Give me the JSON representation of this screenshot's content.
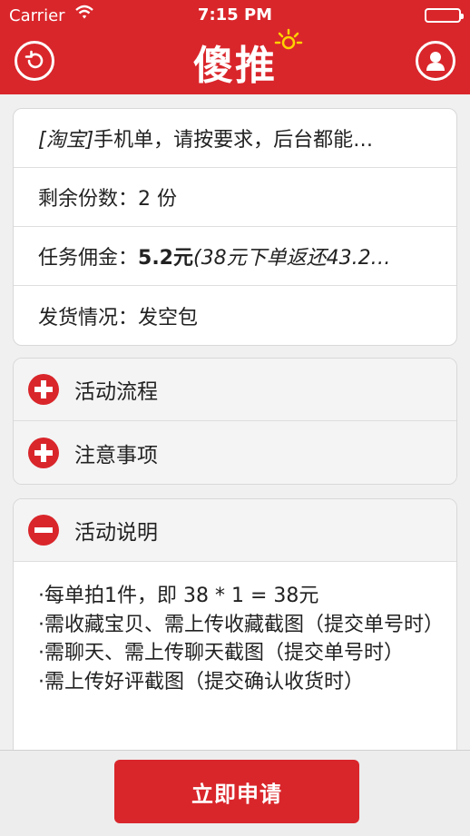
{
  "status_bar": {
    "carrier": "Carrier",
    "time": "7:15 PM"
  },
  "header": {
    "title": "傻推"
  },
  "colors": {
    "brand_red": "#d9262b",
    "background": "#f0f0f0"
  },
  "icons": {
    "back": "back-circle-arrow-icon",
    "profile": "user-profile-icon",
    "expand": "plus-circle-icon",
    "collapse": "minus-circle-icon"
  },
  "task": {
    "title_tag": "[淘宝]",
    "title_text": "手机单，请按要求，后台都能…",
    "remaining_label": "剩余份数：",
    "remaining_value": "2 份",
    "commission_label": "任务佣金：",
    "commission_value": "5.2元",
    "commission_note": "(38元下单返还43.2…",
    "shipping_label": "发货情况：",
    "shipping_value": "发空包"
  },
  "sections": {
    "process": {
      "label": "活动流程",
      "expanded": false
    },
    "notes": {
      "label": "注意事项",
      "expanded": false
    },
    "description": {
      "label": "活动说明",
      "expanded": true,
      "lines": [
        "·每单拍1件，即 38 * 1 = 38元",
        "·需收藏宝贝、需上传收藏截图（提交单号时）",
        "·需聊天、需上传聊天截图（提交单号时）",
        "·需上传好评截图（提交确认收货时）"
      ]
    }
  },
  "footer": {
    "apply_label": "立即申请"
  }
}
